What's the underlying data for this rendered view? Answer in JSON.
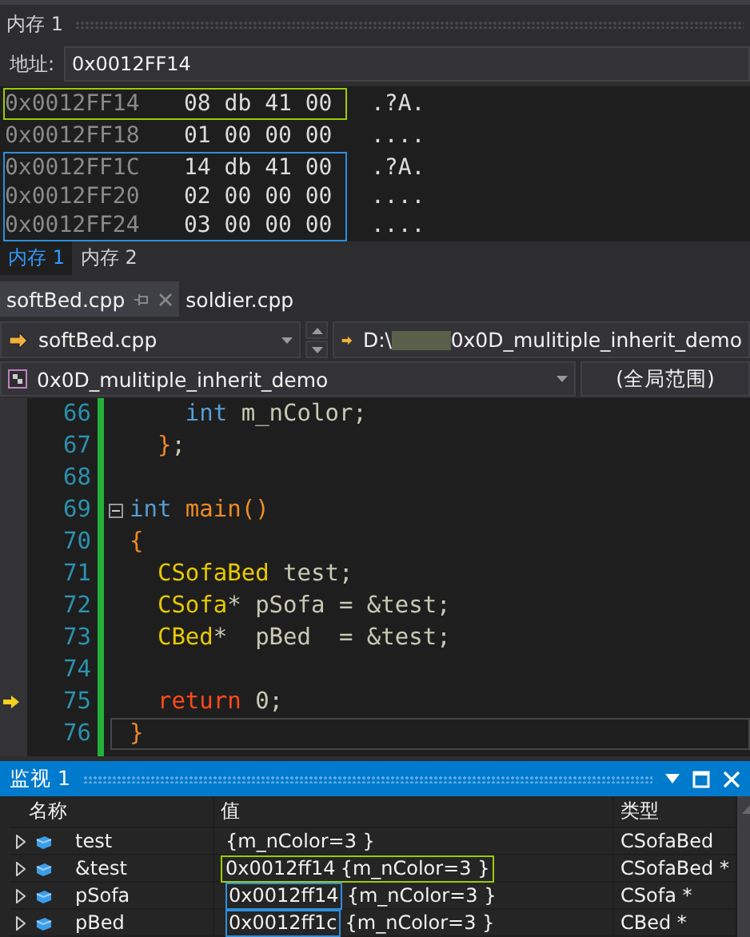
{
  "memory": {
    "title": "内存 1",
    "address_label": "地址:",
    "address": "0x0012FF14",
    "blocks": [
      {
        "color": "#9acd00",
        "rows": [
          {
            "address": "0x0012FF14",
            "bytes": "08 db 41 00",
            "ascii": ".?A."
          }
        ]
      },
      {
        "rows": [
          {
            "address": "0x0012FF18",
            "bytes": "01 00 00 00",
            "ascii": "...."
          }
        ]
      },
      {
        "color": "#2e8fde",
        "rows": [
          {
            "address": "0x0012FF1C",
            "bytes": "14 db 41 00",
            "ascii": ".?A."
          },
          {
            "address": "0x0012FF20",
            "bytes": "02 00 00 00",
            "ascii": "...."
          },
          {
            "address": "0x0012FF24",
            "bytes": "03 00 00 00",
            "ascii": "...."
          }
        ]
      }
    ],
    "tabs": [
      {
        "label": "内存 1",
        "selected": true
      },
      {
        "label": "内存 2",
        "selected": false
      }
    ]
  },
  "editor": {
    "file_tabs": [
      {
        "label": "softBed.cpp",
        "selected": true
      },
      {
        "label": "soldier.cpp",
        "selected": false
      }
    ],
    "file_dropdown": "softBed.cpp",
    "path_start": "D:\\",
    "path_end": "0x0D_mulitiple_inherit_demo",
    "project_dropdown": "0x0D_mulitiple_inherit_demo",
    "scope_dropdown": "(全局范围)",
    "lines": [
      {
        "number": "66",
        "tokens": [
          {
            "kind": "keyword",
            "text": "    int"
          },
          {
            "kind": "var",
            "text": " m_nColor;"
          }
        ]
      },
      {
        "number": "67",
        "tokens": [
          {
            "kind": "punct",
            "text": "  }"
          },
          {
            "kind": "var",
            "text": ";"
          }
        ]
      },
      {
        "number": "68"
      },
      {
        "number": "69",
        "fold": true,
        "tokens": [
          {
            "kind": "keyword",
            "text": "int"
          },
          {
            "kind": "func",
            "text": " main()"
          }
        ]
      },
      {
        "number": "70",
        "tokens": [
          {
            "kind": "punct",
            "text": "{"
          }
        ]
      },
      {
        "number": "71",
        "tokens": [
          {
            "kind": "type",
            "text": "  CSofaBed"
          },
          {
            "kind": "var",
            "text": " test;"
          }
        ]
      },
      {
        "number": "72",
        "tokens": [
          {
            "kind": "type",
            "text": "  CSofa"
          },
          {
            "kind": "var",
            "text": "* pSofa = &test;"
          }
        ]
      },
      {
        "number": "73",
        "tokens": [
          {
            "kind": "type",
            "text": "  CBed"
          },
          {
            "kind": "var",
            "text": "*  pBed  = &test;"
          }
        ]
      },
      {
        "number": "74"
      },
      {
        "number": "75",
        "current": true,
        "tokens": [
          {
            "kind": "control",
            "text": "  return"
          },
          {
            "kind": "var",
            "text": " 0;"
          }
        ]
      },
      {
        "number": "76",
        "caret": true,
        "tokens": [
          {
            "kind": "punct",
            "text": "}"
          }
        ]
      }
    ]
  },
  "watch": {
    "title": "监视 1",
    "columns": [
      "名称",
      "值",
      "类型"
    ],
    "rows": [
      {
        "name": "test",
        "value": "{m_nColor=3 }",
        "type": "CSofaBed",
        "kind": "plain"
      },
      {
        "name": "&test",
        "address": "0x0012ff14",
        "value": "{m_nColor=3 }",
        "type": "CSofaBed *",
        "kind": "boxed-all",
        "color": "#9acd00"
      },
      {
        "name": "pSofa",
        "address": "0x0012ff14",
        "value": "{m_nColor=3 }",
        "type": "CSofa *",
        "kind": "boxed-address",
        "color": "#2e8fde"
      },
      {
        "name": "pBed",
        "address": "0x0012ff1c",
        "value": "{m_nColor=3 }",
        "type": "CBed *",
        "kind": "boxed-address",
        "color": "#2e8fde"
      }
    ]
  }
}
